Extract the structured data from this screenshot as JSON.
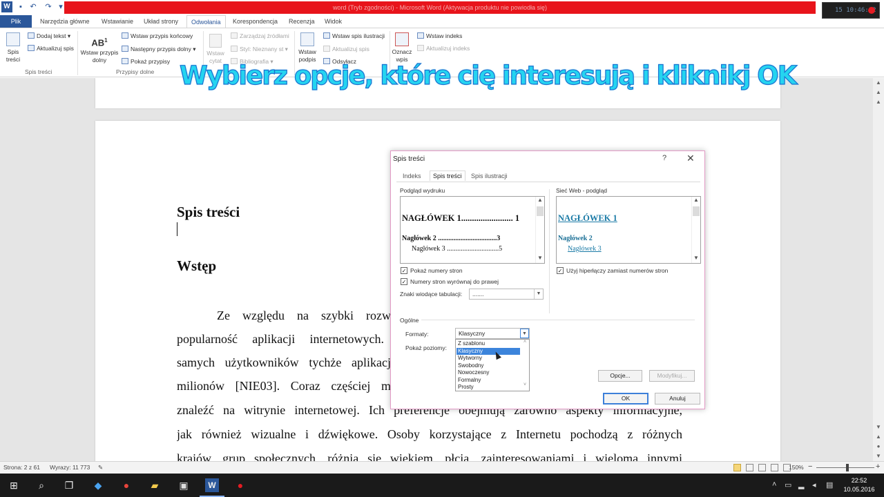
{
  "window": {
    "title_blurred": "word (Tryb zgodności) - Microsoft Word (Aktywacja produktu nie powiodła się)",
    "recorder": "15 10:46:12"
  },
  "tabs": [
    {
      "label": "Plik"
    },
    {
      "label": "Narzędzia główne"
    },
    {
      "label": "Wstawianie"
    },
    {
      "label": "Układ strony"
    },
    {
      "label": "Odwołania"
    },
    {
      "label": "Korespondencja"
    },
    {
      "label": "Recenzja"
    },
    {
      "label": "Widok"
    }
  ],
  "ribbon": {
    "toc_big": "Spis treści",
    "toc_add_text": "Dodaj tekst",
    "toc_update": "Aktualizuj spis",
    "group_toc": "Spis treści",
    "insert_footnote": "Wstaw przypis dolny",
    "insert_endnote": "Wstaw przypis końcowy",
    "next_footnote": "Następny przypis dolny",
    "show_notes": "Pokaż przypisy",
    "group_footnotes": "Przypisy dolne",
    "insert_citation": "Wstaw cytat",
    "manage_sources": "Zarządzaj źródłami",
    "style": "Styl: Nieznany st",
    "bibliography": "Bibliografia",
    "insert_caption": "Wstaw podpis",
    "insert_table_figures": "Wstaw spis ilustracji",
    "update_table": "Aktualizuj spis",
    "cross_ref": "Odsyłacz",
    "mark_entry": "Oznacz wpis",
    "insert_index": "Wstaw indeks",
    "update_index": "Aktualizuj indeks"
  },
  "caption": "Wybierz opcje, które cię interesują i kliknikj OK",
  "document": {
    "heading_toc": "Spis treści",
    "heading_intro": "Wstęp",
    "lines": [
      "Ze względu na szybki rozw",
      "popularność aplikacji internetowych.",
      "samych użytkowników tychże aplikacj",
      "milionów [NIE03]. Coraz częściej m",
      "znaleźć na witrynie internetowej. Ich preferencje obejmują zarówno aspekty informacyjne,",
      "jak również wizualne i dźwiękowe. Osoby korzystające z Internetu pochodzą z różnych",
      "krajów, grup społecznych, różnią się wiekiem, płcią, zainteresowaniami i wieloma innymi"
    ]
  },
  "dialog": {
    "title": "Spis treści",
    "help": "?",
    "close": "✕",
    "tabs": [
      "Indeks",
      "Spis treści",
      "Spis ilustracji"
    ],
    "print_preview_label": "Podgląd wydruku",
    "web_preview_label": "Sieć Web - podgląd",
    "print_preview": {
      "h1": "NAGŁÓWEK 1........................ 1",
      "h2": "Nagłówek 2 ..................................3",
      "h3": "Nagłówek 3 ..............................5"
    },
    "web_preview": {
      "h1": "NAGŁÓWEK 1",
      "h2": "Nagłówek 2",
      "h3": "Nagłówek 3"
    },
    "show_page_numbers": "Pokaż numery stron",
    "right_align": "Numery stron wyrównaj do prawej",
    "tab_leader_label": "Znaki wiodące tabulacji:",
    "tab_leader_value": ".......",
    "use_hyperlinks": "Użyj hiperłączy zamiast numerów stron",
    "general_label": "Ogólne",
    "formats_label": "Formaty:",
    "formats_value": "Klasyczny",
    "show_levels_label": "Pokaż poziomy:",
    "formats_options": [
      "Z szablonu",
      "Klasyczny",
      "Wytworny",
      "Swobodny",
      "Nowoczesny",
      "Formalny",
      "Prosty"
    ],
    "selected_format_index": 1,
    "options_button": "Opcje...",
    "modify_button": "Modyfikuj...",
    "ok_button": "OK",
    "cancel_button": "Anuluj"
  },
  "status": {
    "page": "Strona: 2 z 61",
    "words": "Wyrazy: 11 773",
    "zoom": "150%",
    "zoom_minus": "−",
    "zoom_plus": "+"
  },
  "clock": {
    "time": "22:52",
    "date": "10.05.2016"
  }
}
